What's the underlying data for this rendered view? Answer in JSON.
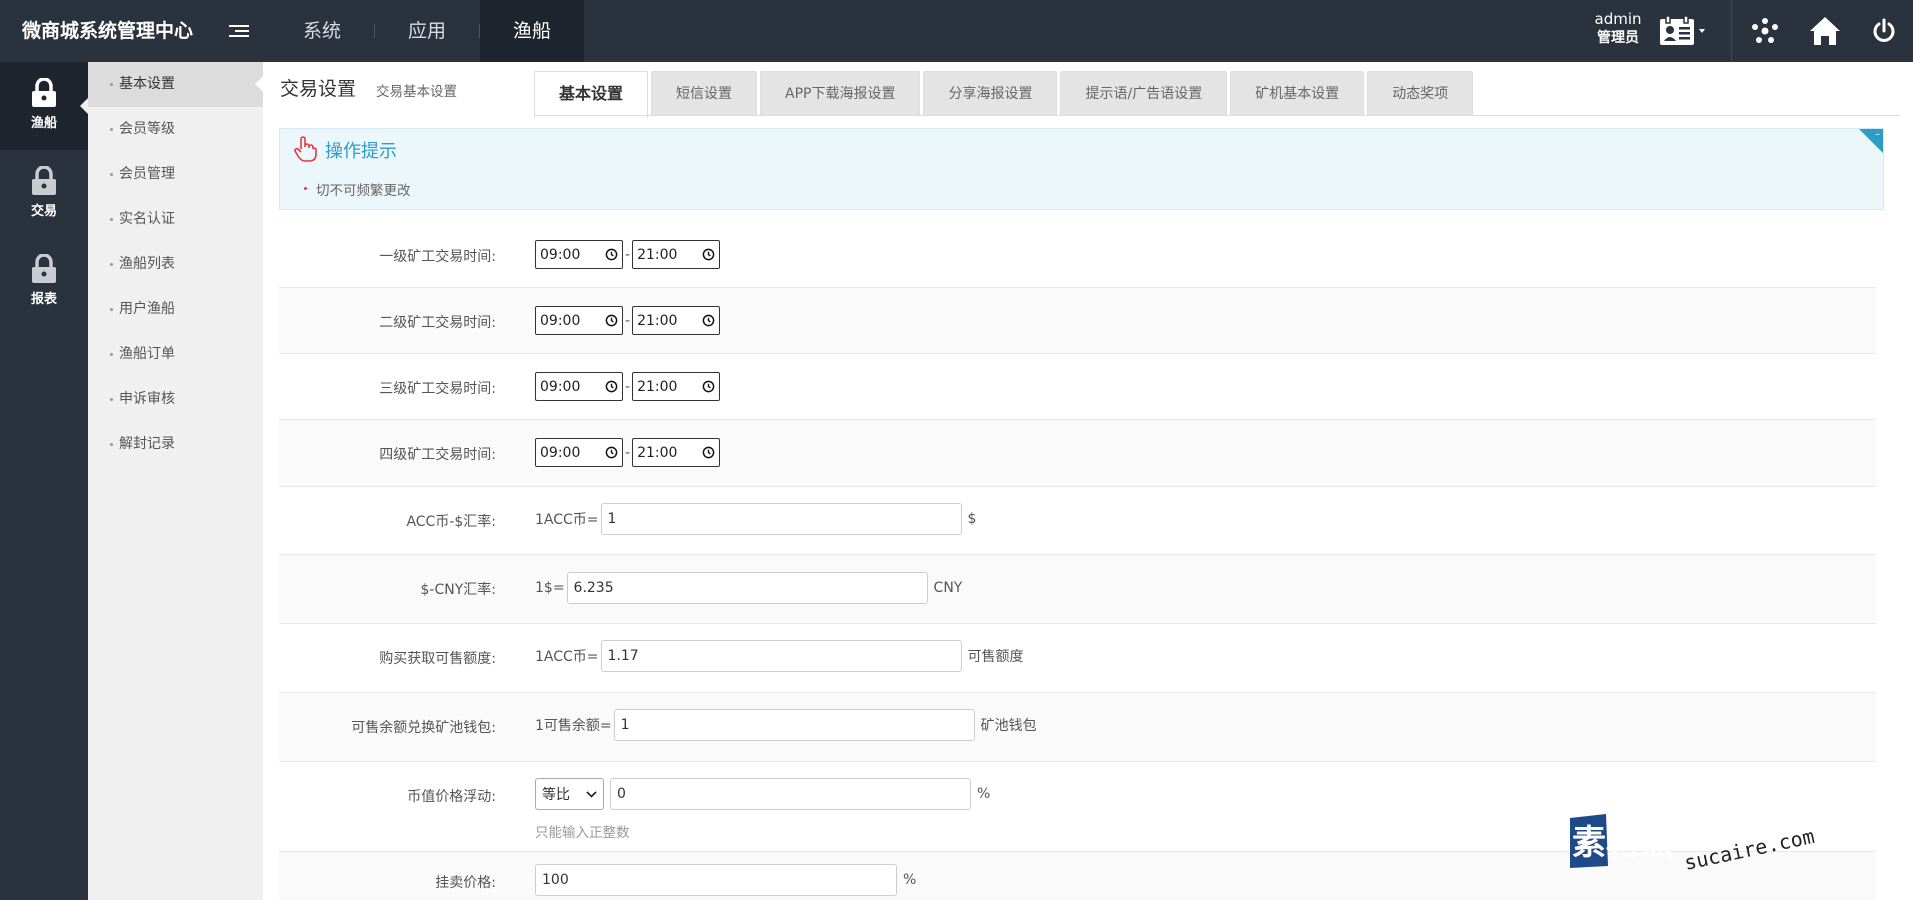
{
  "app": {
    "title": "微商城系统管理中心"
  },
  "topnav": [
    {
      "label": "系统"
    },
    {
      "label": "应用"
    },
    {
      "label": "渔船"
    }
  ],
  "user": {
    "name": "admin",
    "role": "管理员"
  },
  "iconbar": [
    {
      "label": "渔船"
    },
    {
      "label": "交易"
    },
    {
      "label": "报表"
    }
  ],
  "submenu": [
    {
      "label": "基本设置"
    },
    {
      "label": "会员等级"
    },
    {
      "label": "会员管理"
    },
    {
      "label": "实名认证"
    },
    {
      "label": "渔船列表"
    },
    {
      "label": "用户渔船"
    },
    {
      "label": "渔船订单"
    },
    {
      "label": "申诉审核"
    },
    {
      "label": "解封记录"
    }
  ],
  "page": {
    "title": "交易设置",
    "subtitle": "交易基本设置"
  },
  "tabs": [
    {
      "label": "基本设置"
    },
    {
      "label": "短信设置"
    },
    {
      "label": "APP下载海报设置"
    },
    {
      "label": "分享海报设置"
    },
    {
      "label": "提示语/广告语设置"
    },
    {
      "label": "矿机基本设置"
    },
    {
      "label": "动态奖项"
    }
  ],
  "tips": {
    "title": "操作提示",
    "items": [
      "切不可频繁更改"
    ]
  },
  "form": {
    "time_rows": [
      {
        "label": "一级矿工交易时间:",
        "start": "09:00",
        "end": "21:00"
      },
      {
        "label": "二级矿工交易时间:",
        "start": "09:00",
        "end": "21:00"
      },
      {
        "label": "三级矿工交易时间:",
        "start": "09:00",
        "end": "21:00"
      },
      {
        "label": "四级矿工交易时间:",
        "start": "09:00",
        "end": "21:00"
      }
    ],
    "acc_rate": {
      "label": "ACC币-$汇率:",
      "prefix": "1ACC币=",
      "value": "1",
      "suffix": "$"
    },
    "cny_rate": {
      "label": "$-CNY汇率:",
      "prefix": "1$=",
      "value": "6.235",
      "suffix": "CNY"
    },
    "sellable": {
      "label": "购买获取可售额度:",
      "prefix": "1ACC币=",
      "value": "1.17",
      "suffix": "可售额度"
    },
    "exchange": {
      "label": "可售余额兑换矿池钱包:",
      "prefix": "1可售余额=",
      "value": "1",
      "suffix": "矿池钱包"
    },
    "float": {
      "label": "币值价格浮动:",
      "select": "等比",
      "value": "0",
      "suffix": "%",
      "hint": "只能输入正整数"
    },
    "sell_price": {
      "label": "挂卖价格:",
      "value": "100",
      "suffix": "%"
    }
  },
  "watermark": {
    "cn": "素材熱",
    "url": "sucaire.com"
  },
  "colors": {
    "header_bg": "#2a323d",
    "accent": "#2d9dc5",
    "submenu_bg": "#f0f0f0"
  }
}
